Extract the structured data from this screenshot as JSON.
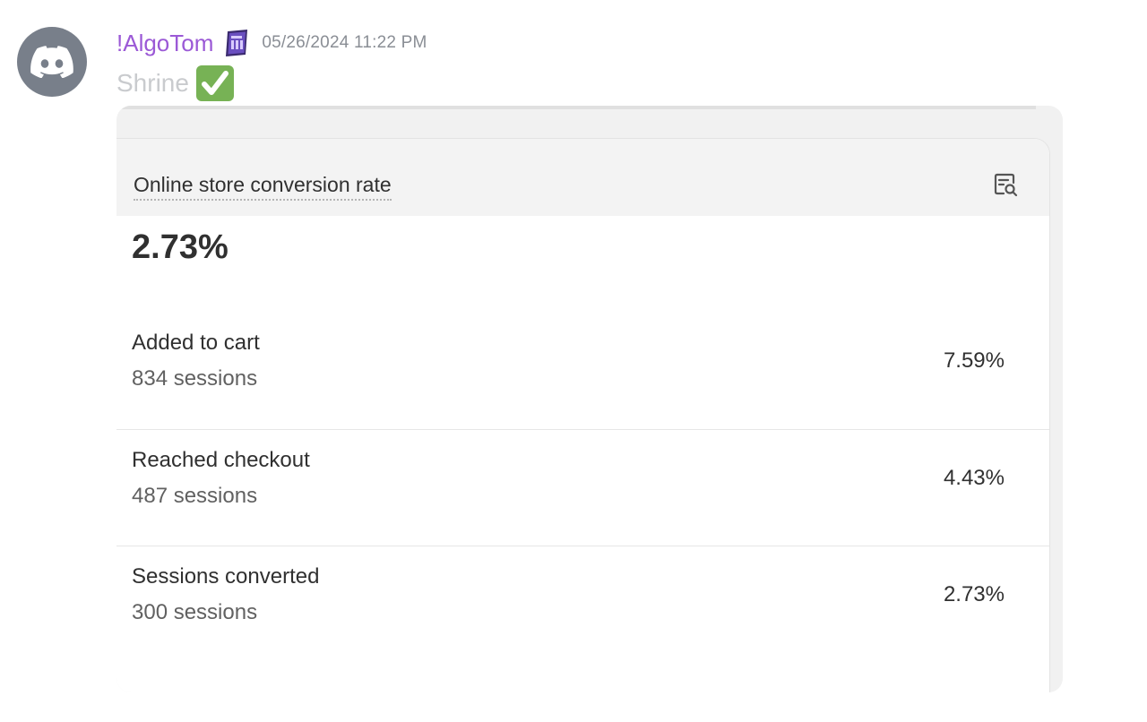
{
  "message": {
    "username": "!AlgoTom",
    "timestamp": "05/26/2024 11:22 PM",
    "text": "Shrine",
    "emoji": "white-check-mark",
    "colors": {
      "username": "#9b59d6",
      "avatar_bg": "#787f8a",
      "check_bg": "#77b255"
    }
  },
  "card": {
    "title": "Online store conversion rate",
    "value": "2.73%",
    "icon": "explore-data-icon",
    "rows": [
      {
        "label": "Added to cart",
        "sessions": "834 sessions",
        "percent": "7.59%"
      },
      {
        "label": "Reached checkout",
        "sessions": "487 sessions",
        "percent": "4.43%"
      },
      {
        "label": "Sessions converted",
        "sessions": "300 sessions",
        "percent": "2.73%"
      }
    ]
  }
}
